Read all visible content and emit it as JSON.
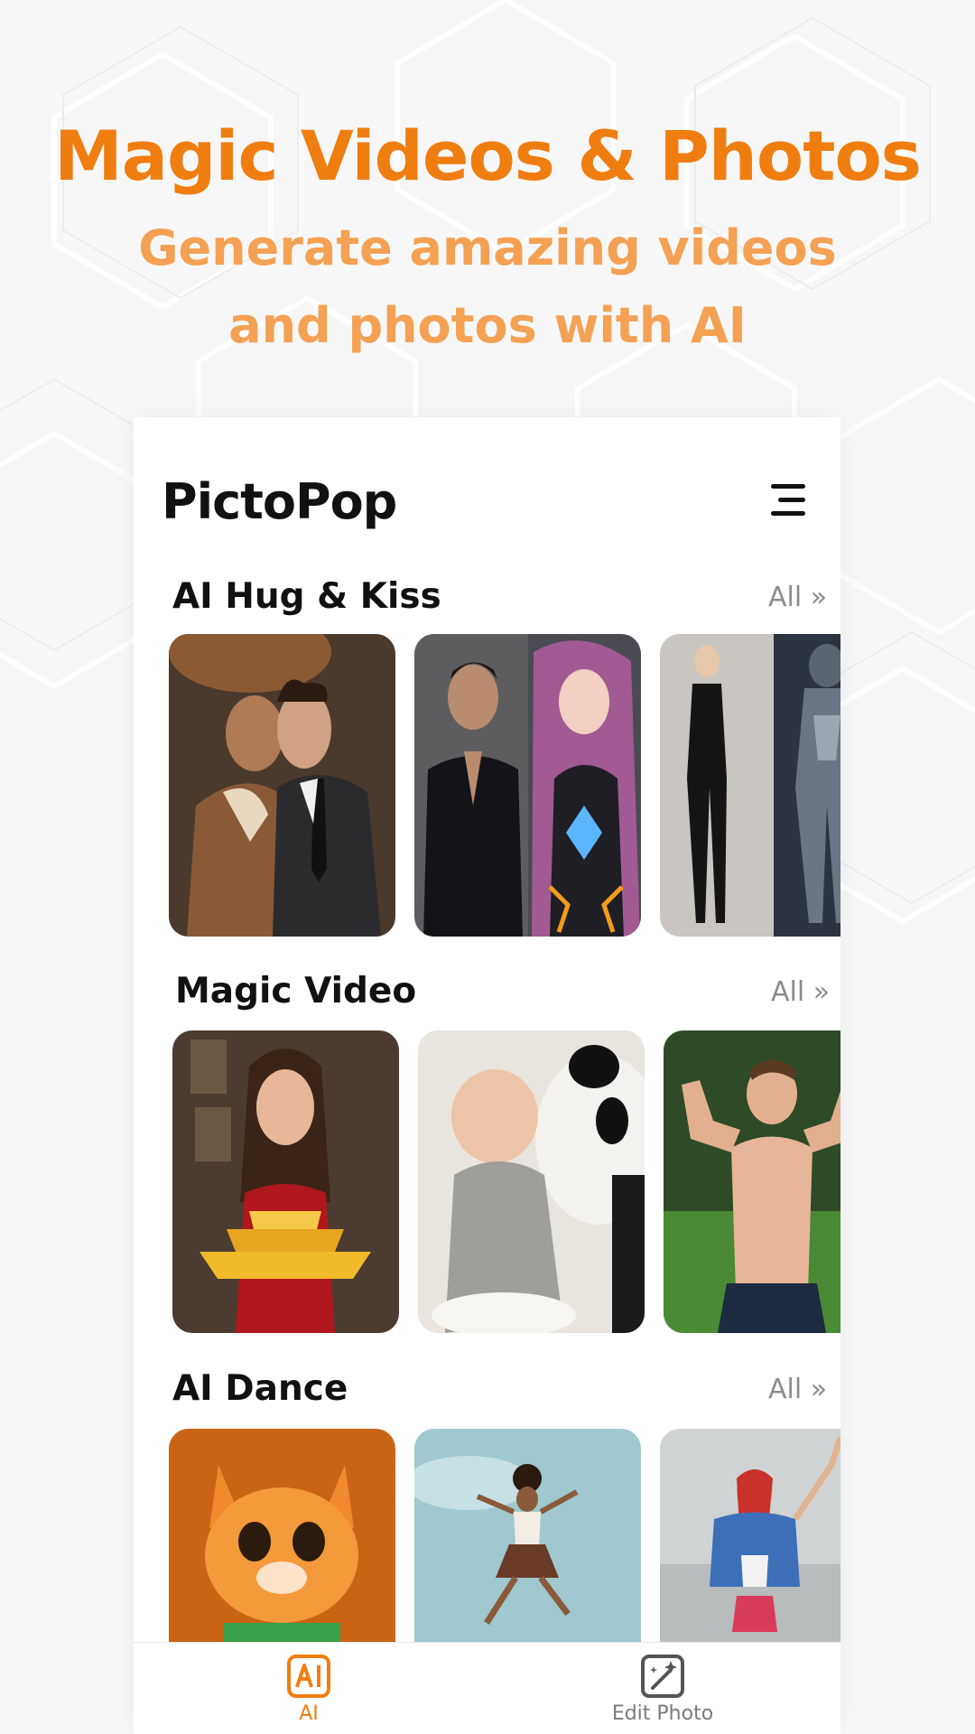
{
  "promo": {
    "headline": "Magic Videos & Photos",
    "subline": "Generate amazing videos and photos with AI"
  },
  "app": {
    "title": "PictoPop",
    "menu_icon": "menu-icon"
  },
  "sections": [
    {
      "title": "AI Hug & Kiss",
      "all_label": "All »",
      "cards": [
        {
          "subject": "couple-kiss"
        },
        {
          "subject": "man-and-heroine"
        },
        {
          "subject": "woman-and-robot"
        }
      ]
    },
    {
      "title": "Magic Video",
      "all_label": "All »",
      "cards": [
        {
          "subject": "woman-with-gold"
        },
        {
          "subject": "baby-and-panda"
        },
        {
          "subject": "muscle-man"
        }
      ]
    },
    {
      "title": "AI Dance",
      "all_label": "All »",
      "cards": [
        {
          "subject": "orange-kitten"
        },
        {
          "subject": "jumping-girl"
        },
        {
          "subject": "dancing-woman"
        }
      ]
    }
  ],
  "bottom_nav": [
    {
      "label": "AI",
      "icon": "ai-icon",
      "active": true
    },
    {
      "label": "Edit Photo",
      "icon": "edit-photo-icon",
      "active": false
    }
  ],
  "colors": {
    "accent": "#f07d10",
    "accent_light": "#f4a154",
    "text_dark": "#111111",
    "text_muted": "#8c8c8c"
  }
}
